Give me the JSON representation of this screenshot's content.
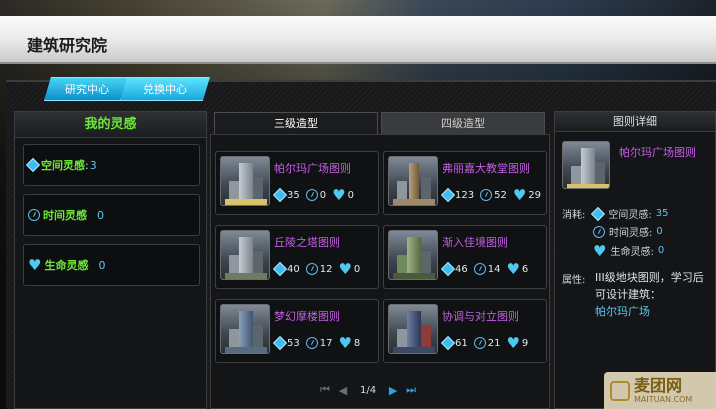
{
  "window": {
    "title": "建筑研究院"
  },
  "top_tabs": [
    "研究中心",
    "兑换中心"
  ],
  "inspiration": {
    "title": "我的灵感",
    "items": [
      {
        "label": "空间灵感",
        "value": "3",
        "icon": "diamond-icon"
      },
      {
        "label": "时间灵感",
        "value": "0",
        "icon": "clock-icon"
      },
      {
        "label": "生命灵感",
        "value": "0",
        "icon": "heart-icon"
      }
    ]
  },
  "sub_tabs": [
    "三级造型",
    "四级造型"
  ],
  "blueprints": [
    {
      "name": "帕尔玛广场图则",
      "space": "35",
      "time": "0",
      "life": "0"
    },
    {
      "name": "弗丽嘉大教堂图则",
      "space": "123",
      "time": "52",
      "life": "29"
    },
    {
      "name": "丘陵之塔图则",
      "space": "40",
      "time": "12",
      "life": "0"
    },
    {
      "name": "渐入佳境图则",
      "space": "46",
      "time": "14",
      "life": "6"
    },
    {
      "name": "梦幻摩楼图则",
      "space": "53",
      "time": "17",
      "life": "8"
    },
    {
      "name": "协调与对立图则",
      "space": "61",
      "time": "21",
      "life": "9"
    }
  ],
  "pager": {
    "page": "1/4"
  },
  "detail": {
    "title": "图则详细",
    "name": "帕尔玛广场图则",
    "cost_label": "消耗:",
    "costs": [
      {
        "label": "空间灵感:",
        "value": "35"
      },
      {
        "label": "时间灵感:",
        "value": "0"
      },
      {
        "label": "生命灵感:",
        "value": "0"
      }
    ],
    "attr_label": "属性:",
    "attr_text": "III级地块图则，学习后可设计建筑：",
    "attr_building": "帕尔玛广场"
  },
  "watermark": {
    "cn": "麦团网",
    "en": "MAITUAN.COM"
  },
  "colors": {
    "accent": "#1aa7de",
    "green": "#6de83a",
    "purple": "#c45fe6",
    "value_blue": "#5fc5f0"
  }
}
